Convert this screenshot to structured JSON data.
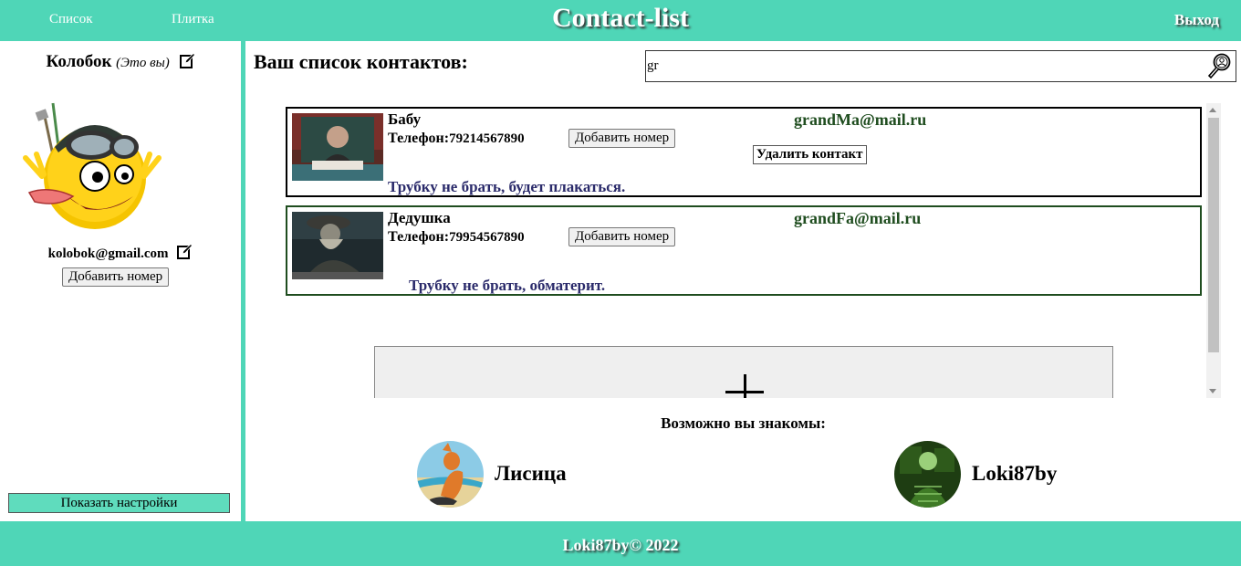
{
  "header": {
    "nav": [
      "Список",
      "Плитка"
    ],
    "title": "Contact-list",
    "logout": "Выход"
  },
  "profile": {
    "name": "Колобок",
    "note": "(Это вы)",
    "email": "kolobok@gmail.com",
    "add_phone_label": "Добавить номер",
    "show_settings_label": "Показать настройки"
  },
  "main": {
    "title": "Ваш список контактов:",
    "search": {
      "value": "gr",
      "placeholder": ""
    },
    "phone_label": "Телефон:",
    "add_phone_label": "Добавить номер",
    "delete_label": "Удалить контакт",
    "add_contact_symbol": "+",
    "contacts": [
      {
        "name": "Бабу",
        "phone": "79214567890",
        "email": "grandMa@mail.ru",
        "note": "Трубку не брать, будет плакаться."
      },
      {
        "name": "Дедушка",
        "phone": "79954567890",
        "email": "grandFa@mail.ru",
        "note": "Трубку не брать, обматерит."
      }
    ]
  },
  "suggestions": {
    "title": "Возможно вы знакомы:",
    "people": [
      {
        "name": "Лисица"
      },
      {
        "name": "Loki87by"
      }
    ]
  },
  "footer": {
    "text": "Loki87by© 2022"
  },
  "colors": {
    "accent": "#4fd6b7",
    "settings_button": "#5fdcbd",
    "email": "#1f4d1f",
    "note": "#2b2b6b"
  },
  "icons": [
    "edit-icon",
    "search-icon",
    "plus-icon"
  ]
}
